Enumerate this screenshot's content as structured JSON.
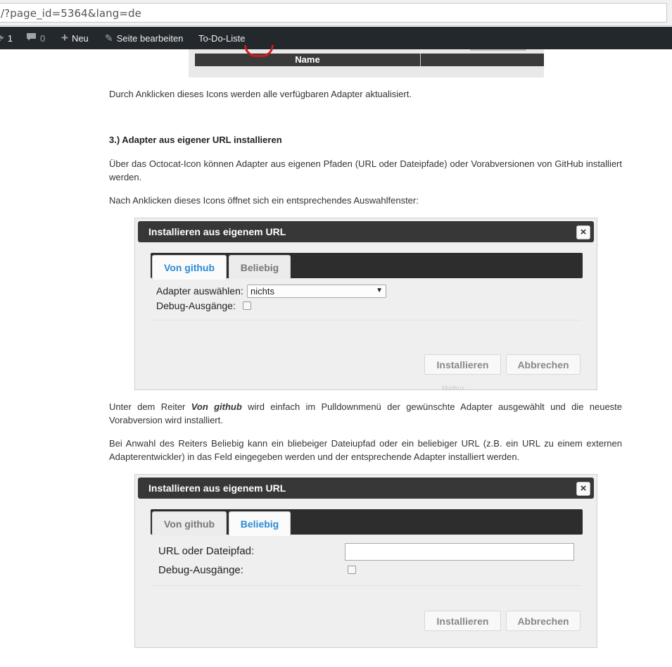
{
  "browser": {
    "url": "/?page_id=5364&lang=de"
  },
  "adminbar": {
    "updates_count": "1",
    "comments_count": "0",
    "new_label": "Neu",
    "edit_label": "Seite bearbeiten",
    "todo_label": "To-Do-Liste"
  },
  "top_image": {
    "header_label": "Name"
  },
  "article": {
    "p1": "Durch Anklicken dieses Icons werden alle verfügbaren Adapter aktualisiert.",
    "heading": "3.) Adapter aus eigener URL installieren",
    "p2": "Über das Octocat-Icon können Adapter aus eigenen Pfaden (URL oder Dateipfade) oder Vorabversionen von GitHub installiert werden.",
    "p3": "Nach Anklicken dieses Icons öffnet sich ein entsprechendes Auswahlfenster:",
    "p4_pre": "Unter dem Reiter ",
    "p4_em": "Von github",
    "p4_post": " wird einfach im Pulldownmenü der gewünschte Adapter ausgewählt und die neueste Vorabversion wird installiert.",
    "p5": "Bei Anwahl des Reiters Beliebig kann ein bliebeiger Dateiupfad oder ein beliebiger URL (z.B. ein URL zu einem externen Adapterentwickler) in das Feld eingegeben werden und der entsprechende Adapter installiert werden."
  },
  "dialog1": {
    "title": "Installieren aus eigenem URL",
    "close": "×",
    "tabs": [
      "Von github",
      "Beliebig"
    ],
    "active_tab": "Von github",
    "adapter_label": "Adapter auswählen:",
    "adapter_value": "nichts",
    "debug_label": "Debug-Ausgänge:",
    "debug_checked": false,
    "install_button": "Installieren",
    "cancel_button": "Abbrechen",
    "faint_text": "Modbus"
  },
  "dialog2": {
    "title": "Installieren aus eigenem URL",
    "close": "×",
    "tabs": [
      "Von github",
      "Beliebig"
    ],
    "active_tab": "Beliebig",
    "url_label": "URL oder Dateipfad:",
    "url_value": "",
    "debug_label": "Debug-Ausgänge:",
    "debug_checked": false,
    "install_button": "Installieren",
    "cancel_button": "Abbrechen"
  },
  "colors": {
    "adminbar_bg": "#23282d",
    "dialog_title_bg": "#373737",
    "active_tab_text": "#2a8ad6"
  }
}
